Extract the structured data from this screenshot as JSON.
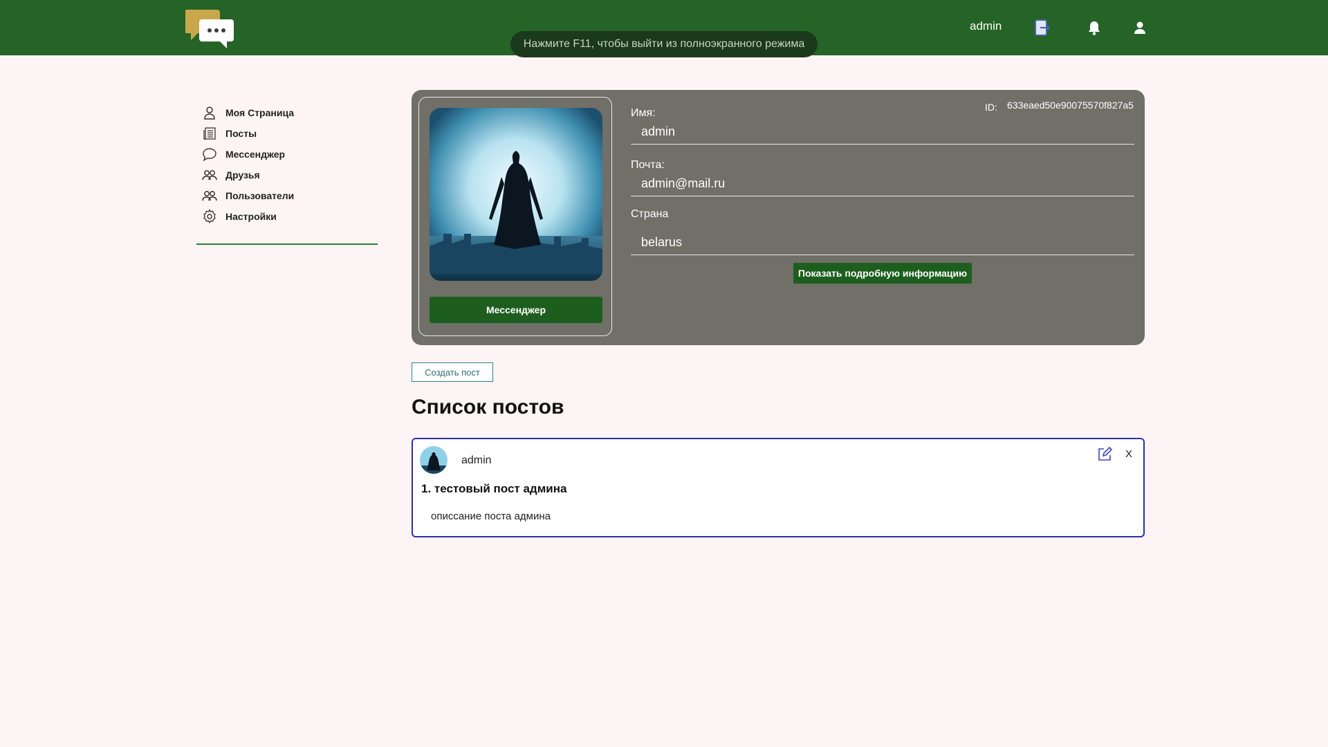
{
  "header": {
    "fullscreen_notice": "Нажмите F11, чтобы выйти из полноэкранного режима",
    "username": "admin",
    "icons": [
      "chat-logo-icon",
      "logout-icon",
      "bell-icon",
      "user-icon"
    ]
  },
  "sidebar": {
    "items": [
      {
        "label": "Моя Страница",
        "icon": "person-icon"
      },
      {
        "label": "Посты",
        "icon": "posts-icon"
      },
      {
        "label": "Мессенджер",
        "icon": "chat-bubble-icon"
      },
      {
        "label": "Друзья",
        "icon": "friends-icon"
      },
      {
        "label": "Пользователи",
        "icon": "users-icon"
      },
      {
        "label": "Настройки",
        "icon": "gear-icon"
      }
    ]
  },
  "profile": {
    "name_label": "Имя:",
    "name_value": "admin",
    "email_label": "Почта:",
    "email_value": "admin@mail.ru",
    "country_label": "Страна",
    "country_value": "belarus",
    "id_label": "ID:",
    "id_value": "633eaed50e90075570f827a5",
    "messenger_button": "Мессенджер",
    "details_button": "Показать подробную информацию"
  },
  "create_post_button": "Создать пост",
  "posts_title": "Список постов",
  "posts": [
    {
      "author": "admin",
      "title": "1. тестовый пост админа",
      "body": "описсание поста админа",
      "close_label": "X"
    }
  ],
  "colors": {
    "header": "#256326",
    "page_bg": "#fdf5f5",
    "card_bg": "#706f68",
    "button_green": "#1d5e1f",
    "post_border": "#2c2fa8"
  }
}
